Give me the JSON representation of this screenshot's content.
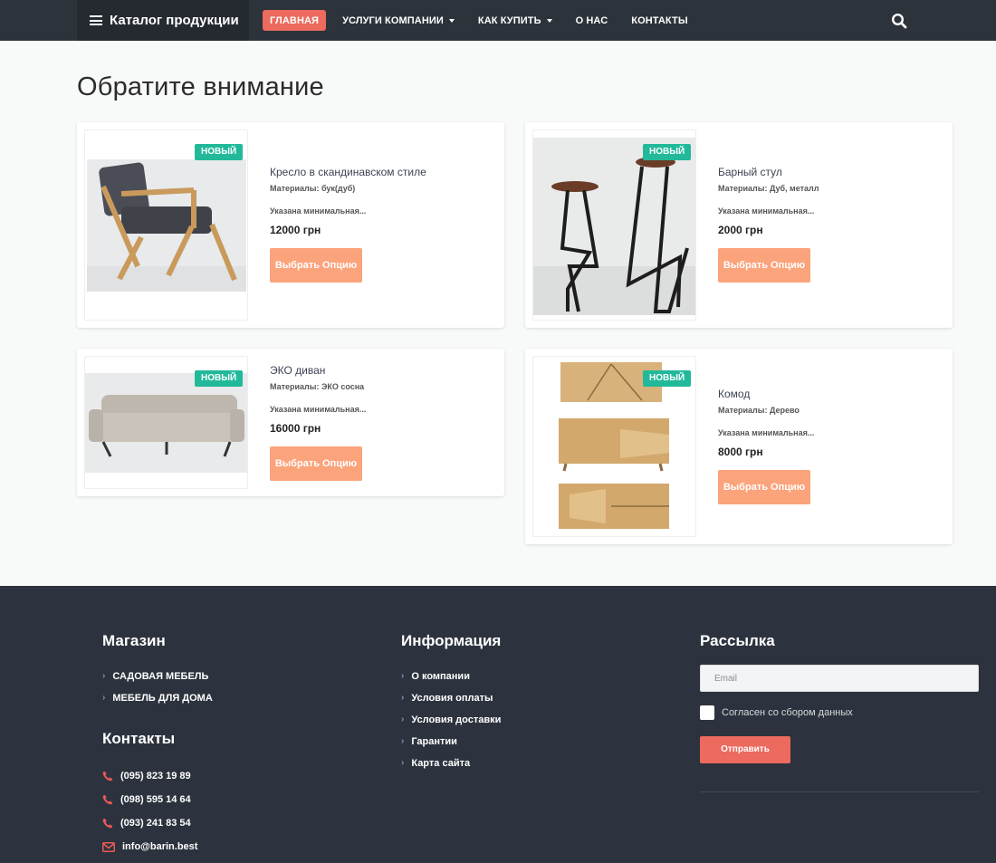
{
  "nav": {
    "brand": "Каталог продукции",
    "items": [
      {
        "label": "ГЛАВНАЯ"
      },
      {
        "label": "УСЛУГИ КОМПАНИИ"
      },
      {
        "label": "КАК КУПИТЬ"
      },
      {
        "label": "О НАС"
      },
      {
        "label": "КОНТАКТЫ"
      }
    ]
  },
  "main": {
    "heading": "Обратите внимание",
    "products": [
      {
        "badge": "НОВЫЙ",
        "title": "Кресло в скандинавском стиле",
        "materials": "Материалы: бук(дуб)",
        "desc": "Указана минимальная...",
        "price": "12000 грн",
        "button": "Выбрать Опцию"
      },
      {
        "badge": "НОВЫЙ",
        "title": "Барный стул",
        "materials": "Материалы: Дуб, металл",
        "desc": "Указана минимальная...",
        "price": "2000 грн",
        "button": "Выбрать Опцию"
      },
      {
        "badge": "НОВЫЙ",
        "title": "ЭКО диван",
        "materials": "Материалы: ЭКО сосна",
        "desc": "Указана минимальная...",
        "price": "16000 грн",
        "button": "Выбрать Опцию"
      },
      {
        "badge": "НОВЫЙ",
        "title": "Комод",
        "materials": "Материалы: Дерево",
        "desc": "Указана минимальная...",
        "price": "8000 грн",
        "button": "Выбрать Опцию"
      }
    ]
  },
  "footer": {
    "shop": {
      "title": "Магазин",
      "links": [
        "САДОВАЯ МЕБЕЛЬ",
        "МЕБЕЛЬ ДЛЯ ДОМА"
      ]
    },
    "contacts": {
      "title": "Контакты",
      "phones": [
        "(095) 823 19 89",
        "(098) 595 14 64",
        "(093) 241 83 54"
      ],
      "email": "info@barin.best"
    },
    "info": {
      "title": "Информация",
      "links": [
        "О компании",
        "Условия оплаты",
        "Условия доставки",
        "Гарантии",
        "Карта сайта"
      ]
    },
    "newsletter": {
      "title": "Рассылка",
      "placeholder": "Email",
      "agree": "Согласен со сбором данных",
      "submit": "Отправить"
    }
  },
  "colors": {
    "nav_bg": "#2d333b",
    "accent": "#ec6a5e",
    "badge": "#21b99a",
    "button": "#fba37b",
    "footer_bg": "#2d333e"
  },
  "icons": {
    "menu": "hamburger-icon",
    "search": "search-icon",
    "phone": "phone-icon",
    "email": "envelope-icon"
  }
}
